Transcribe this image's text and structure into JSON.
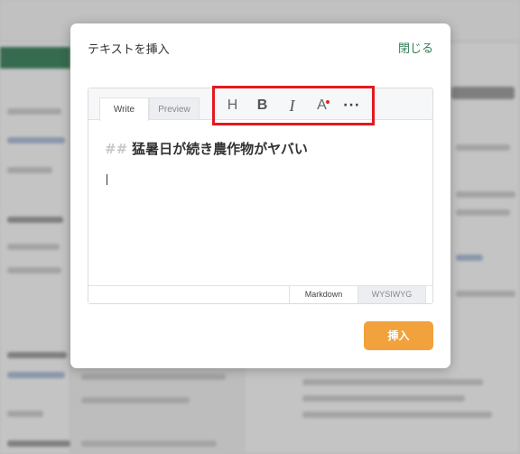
{
  "dialog": {
    "title": "テキストを挿入",
    "close_label": "閉じる",
    "insert_label": "挿入"
  },
  "editor": {
    "tabs": [
      {
        "label": "Write",
        "active": true
      },
      {
        "label": "Preview",
        "active": false
      }
    ],
    "toolbar": {
      "heading": "H",
      "bold": "B",
      "italic": "I",
      "font_color": "A",
      "more": "···"
    },
    "content": {
      "heading_marker": "##",
      "heading_text": "猛暑日が続き農作物がヤバい"
    },
    "modes": [
      {
        "label": "Markdown",
        "active": true
      },
      {
        "label": "WYSIWYG",
        "active": false
      }
    ]
  },
  "colors": {
    "accent_green": "#2f7d55",
    "insert_orange": "#f1a23c",
    "highlight_red": "#e3191f",
    "font_color_dot": "#e02525"
  }
}
